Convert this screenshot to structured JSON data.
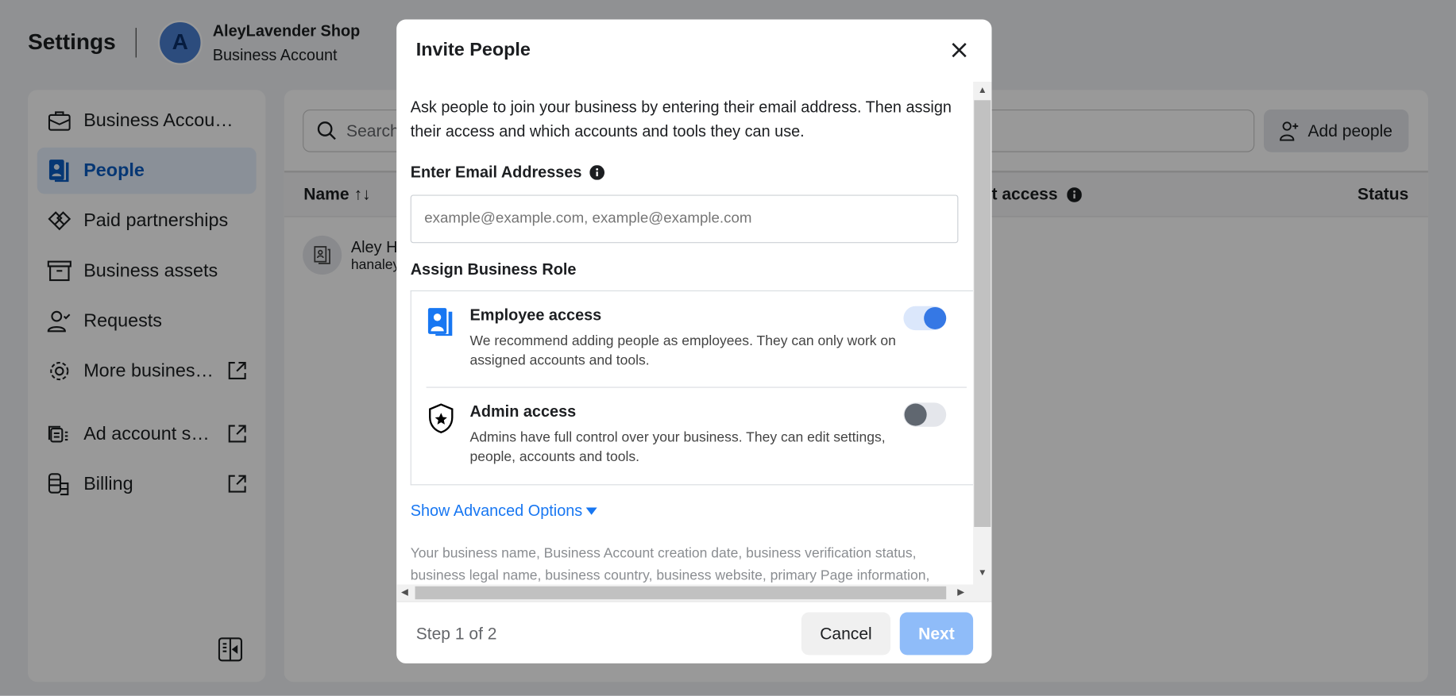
{
  "header": {
    "title": "Settings",
    "account_initial": "A",
    "account_name": "AleyLavender Shop",
    "account_type": "Business Account"
  },
  "sidebar": {
    "items": [
      {
        "label": "Business Accou…",
        "icon": "briefcase-icon"
      },
      {
        "label": "People",
        "icon": "badge-icon",
        "active": true
      },
      {
        "label": "Paid partnerships",
        "icon": "handshake-icon"
      },
      {
        "label": "Business assets",
        "icon": "archive-box-icon"
      },
      {
        "label": "Requests",
        "icon": "person-check-icon"
      },
      {
        "label": "More busines…",
        "icon": "gear-icon",
        "external": true
      },
      {
        "label": "Ad account s…",
        "icon": "ad-account-icon",
        "external": true
      },
      {
        "label": "Billing",
        "icon": "coins-icon",
        "external": true
      }
    ]
  },
  "main": {
    "search_placeholder": "Search",
    "add_people_label": "Add people",
    "columns": {
      "name": "Name",
      "sort_icon": "↑↓",
      "access": "unt access",
      "status": "Status"
    },
    "rows": [
      {
        "name": "Aley H",
        "email": "hanaley"
      }
    ]
  },
  "modal": {
    "title": "Invite People",
    "intro": "Ask people to join your business by entering their email address. Then assign their access and which accounts and tools they can use.",
    "email_label": "Enter Email Addresses",
    "email_placeholder": "example@example.com, example@example.com",
    "email_value": "",
    "role_label": "Assign Business Role",
    "roles": [
      {
        "title": "Employee access",
        "description": "We recommend adding people as employees. They can only work on assigned accounts and tools.",
        "enabled": true
      },
      {
        "title": "Admin access",
        "description": "Admins have full control over your business. They can edit settings, people, accounts and tools.",
        "enabled": false
      }
    ],
    "advanced_label": "Show Advanced Options",
    "fine_print": "Your business name, Business Account creation date, business verification status, business legal name, business country, business website, primary Page information,",
    "step": "Step 1 of 2",
    "cancel_label": "Cancel",
    "next_label": "Next"
  },
  "colors": {
    "accent": "#1877f2",
    "toggle_on": "#3578e5",
    "next_disabled": "#8fbcf9"
  }
}
